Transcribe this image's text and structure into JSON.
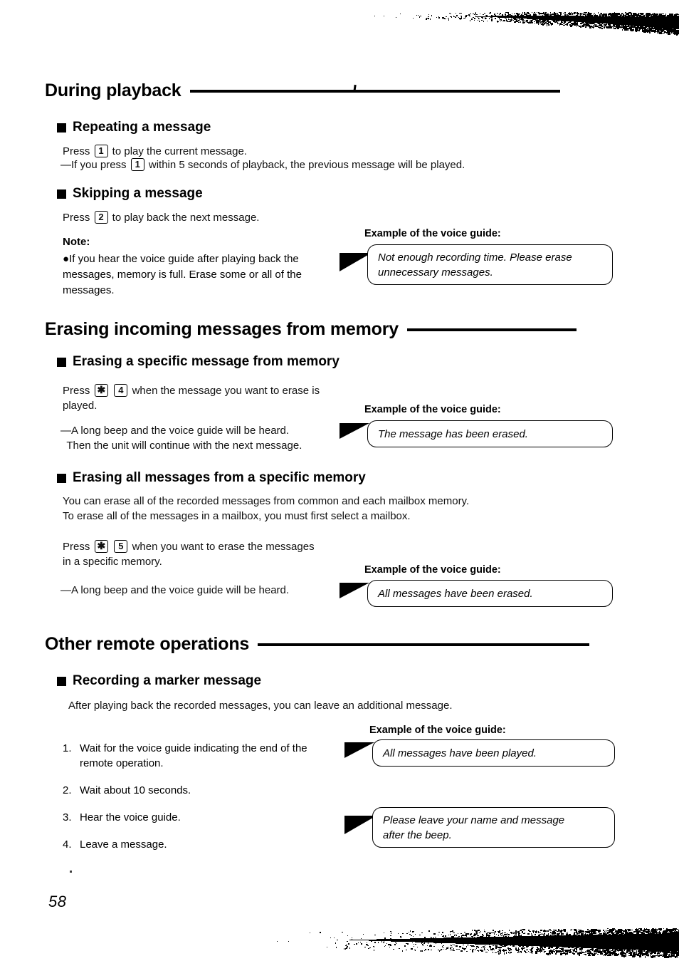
{
  "page": {
    "number": "58"
  },
  "sections": [
    {
      "title": "During playback",
      "subsections": [
        {
          "title": "Repeating a message",
          "lines": [
            "Press 1 to play the current message.",
            "—If you press 1 within 5 seconds of playback, the previous message will be played."
          ]
        },
        {
          "title": "Skipping a message",
          "lines": [
            "Press 2 to play back the next message."
          ],
          "note_label": "Note:",
          "note_text": "If you hear the voice guide after playing back the\nmessages, memory is full. Erase some or all of the\nmessages."
        }
      ]
    },
    {
      "title": "Erasing incoming messages from memory",
      "subsections": [
        {
          "title": "Erasing a specific message from memory",
          "press_line_1": "when the message you want to erase is",
          "press_line_2": "played.",
          "result": "—A long beep and the voice guide will be heard.\n  Then the unit will continue with the next message."
        },
        {
          "title": "Erasing all messages from a specific memory",
          "intro": "You can erase all of the recorded messages from common and each mailbox memory.\nTo erase all of the messages in a mailbox, you must first select a mailbox.",
          "press_line_1": "when you want to erase the messages",
          "press_line_2": "in a specific memory.",
          "result": "—A long beep and the voice guide will be heard."
        }
      ]
    },
    {
      "title": "Other remote operations",
      "subsections": [
        {
          "title": "Recording a marker message",
          "intro": "After playing back the recorded messages, you can leave an additional message.",
          "steps": [
            {
              "num": "1.",
              "text": "Wait for the voice guide indicating the end of the\nremote operation."
            },
            {
              "num": "2.",
              "text": "Wait about 10 seconds."
            },
            {
              "num": "3.",
              "text": "Hear the voice guide."
            },
            {
              "num": "4.",
              "text": "Leave a message."
            }
          ]
        }
      ]
    }
  ],
  "keys": {
    "one": "1",
    "two": "2",
    "four": "4",
    "five": "5",
    "star": "✱"
  },
  "press_word": "Press",
  "callouts": [
    {
      "label": "Example of the voice guide:",
      "text": "Not enough recording time. Please erase\nunnecessary messages."
    },
    {
      "label": "Example of the voice guide:",
      "text": "The message has been erased."
    },
    {
      "label": "Example of the voice guide:",
      "text": "All messages have been erased."
    },
    {
      "label": "Example of the voice guide:",
      "text": "All messages have been played."
    },
    {
      "label": "",
      "text": "Please leave your name and message\nafter the beep."
    }
  ]
}
